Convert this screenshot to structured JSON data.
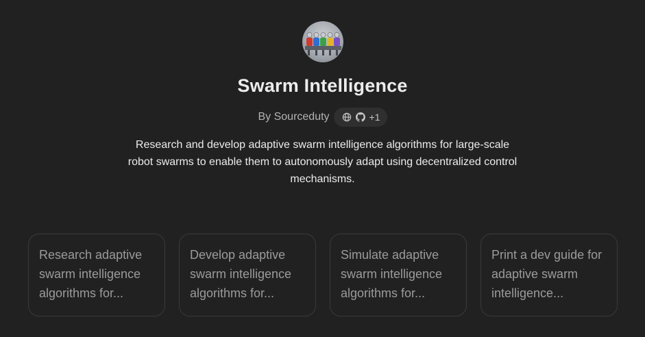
{
  "gpt": {
    "avatar_icon": "robot-swarm-avatar",
    "title": "Swarm Intelligence",
    "byline": "By Sourceduty",
    "links": {
      "icons": [
        "globe-icon",
        "github-icon"
      ],
      "more_label": "+1"
    },
    "description": "Research and develop adaptive swarm intelligence algorithms for large-scale robot swarms to enable them to autonomously adapt using decentralized control mechanisms."
  },
  "conversation_starters": [
    {
      "text": "Research adaptive swarm intelligence algorithms for..."
    },
    {
      "text": "Develop adaptive swarm intelligence algorithms for..."
    },
    {
      "text": "Simulate adaptive swarm intelligence algorithms for..."
    },
    {
      "text": "Print a dev guide for adaptive swarm intelligence..."
    }
  ],
  "colors": {
    "background": "#212121",
    "card_border": "#3a3a3a",
    "pill_background": "#2f2f2f",
    "muted_text": "#9b9b9b"
  }
}
